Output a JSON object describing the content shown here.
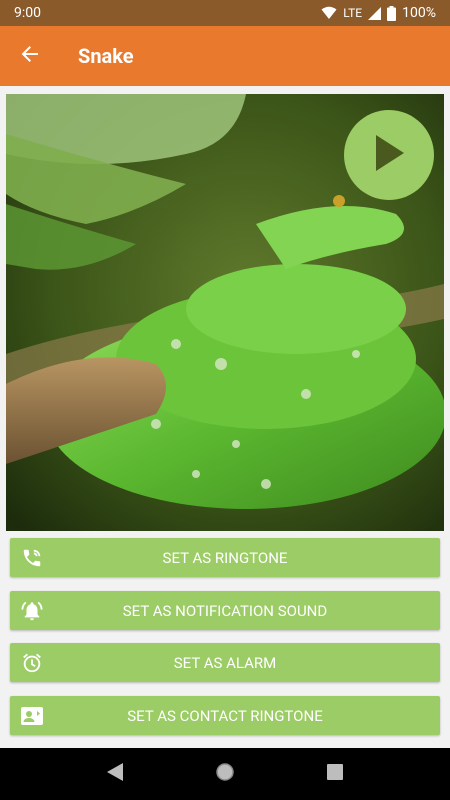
{
  "status_bar": {
    "time": "9:00",
    "network": "LTE",
    "battery": "100%",
    "icons": [
      "wifi-icon",
      "signal-icon",
      "battery-icon"
    ]
  },
  "app_bar": {
    "title": "Snake",
    "back_icon": "arrow-back-icon",
    "color": "#e8792d"
  },
  "media": {
    "image_subject": "green tree snake coiled on branch",
    "play_icon": "play-icon",
    "play_color": "#9ccc65"
  },
  "actions": [
    {
      "label": "SET AS RINGTONE",
      "icon": "phone-ring-icon"
    },
    {
      "label": "SET AS NOTIFICATION SOUND",
      "icon": "bell-ring-icon"
    },
    {
      "label": "SET AS ALARM",
      "icon": "alarm-clock-icon"
    },
    {
      "label": "SET AS CONTACT RINGTONE",
      "icon": "contact-card-icon"
    }
  ],
  "accent": "#9ccc65",
  "nav_bar": {
    "buttons": [
      "back-triangle-icon",
      "home-circle-icon",
      "recents-square-icon"
    ]
  }
}
